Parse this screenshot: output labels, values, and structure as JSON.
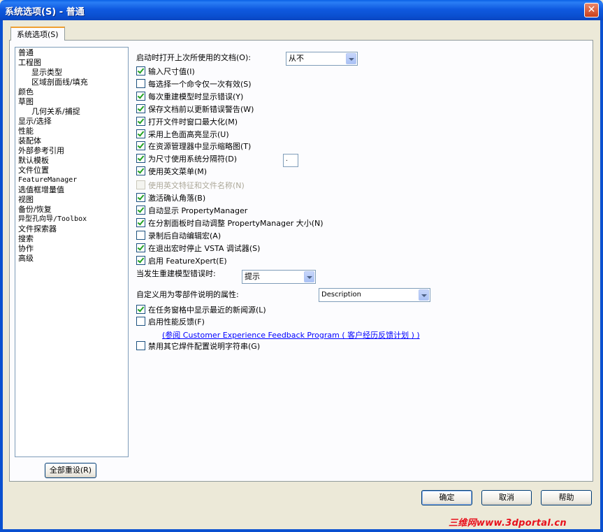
{
  "window": {
    "title": "系统选项(S) - 普通",
    "close_glyph": "✕"
  },
  "tab": {
    "label": "系统选项(S)"
  },
  "tree": [
    {
      "label": "普通",
      "indent": false
    },
    {
      "label": "工程图",
      "indent": false
    },
    {
      "label": "显示类型",
      "indent": true
    },
    {
      "label": "区域剖面线/填充",
      "indent": true
    },
    {
      "label": "颜色",
      "indent": false
    },
    {
      "label": "草图",
      "indent": false
    },
    {
      "label": "几何关系/捕捉",
      "indent": true
    },
    {
      "label": "显示/选择",
      "indent": false
    },
    {
      "label": "性能",
      "indent": false
    },
    {
      "label": "装配体",
      "indent": false
    },
    {
      "label": "外部参考引用",
      "indent": false
    },
    {
      "label": "默认模板",
      "indent": false
    },
    {
      "label": "文件位置",
      "indent": false
    },
    {
      "label": "FeatureManager",
      "indent": false,
      "mono": true
    },
    {
      "label": "选值框增量值",
      "indent": false
    },
    {
      "label": "视图",
      "indent": false
    },
    {
      "label": "备份/恢复",
      "indent": false
    },
    {
      "label": "异型孔向导/Toolbox",
      "indent": false,
      "mono": true
    },
    {
      "label": "文件探索器",
      "indent": false
    },
    {
      "label": "搜索",
      "indent": false
    },
    {
      "label": "协作",
      "indent": false
    },
    {
      "label": "高级",
      "indent": false
    }
  ],
  "reset_button": "全部重设(R)",
  "open_docs": {
    "label": "启动时打开上次所使用的文档(O):",
    "value": "从不"
  },
  "options": [
    {
      "label": "输入尺寸值(I)",
      "checked": true,
      "enabled": true
    },
    {
      "label": "每选择一个命令仅一次有效(S)",
      "checked": false,
      "enabled": true
    },
    {
      "label": "每次重建模型时显示错误(Y)",
      "checked": true,
      "enabled": true
    },
    {
      "label": "保存文档前以更新错误警告(W)",
      "checked": true,
      "enabled": true
    },
    {
      "label": "打开文件时窗口最大化(M)",
      "checked": true,
      "enabled": true
    },
    {
      "label": "采用上色面高亮显示(U)",
      "checked": true,
      "enabled": true
    },
    {
      "label": "在资源管理器中显示缩略图(T)",
      "checked": true,
      "enabled": true
    },
    {
      "label": "为尺寸使用系统分隔符(D)",
      "checked": true,
      "enabled": true
    },
    {
      "label": "使用英文菜单(M)",
      "checked": true,
      "enabled": true
    },
    {
      "label": "使用英文特征和文件名称(N)",
      "checked": false,
      "enabled": false
    },
    {
      "label": "激活确认角落(B)",
      "checked": true,
      "enabled": true
    },
    {
      "label": "自动显示 PropertyManager",
      "checked": true,
      "enabled": true
    },
    {
      "label": "在分割面板时自动调整 PropertyManager 大小(N)",
      "checked": true,
      "enabled": true
    },
    {
      "label": "录制后自动编辑宏(A)",
      "checked": false,
      "enabled": true
    },
    {
      "label": "在退出宏时停止 VSTA 调试器(S)",
      "checked": true,
      "enabled": true
    },
    {
      "label": "启用 FeatureXpert(E)",
      "checked": true,
      "enabled": true
    }
  ],
  "separator_value": ".",
  "rebuild_error": {
    "label": "当发生重建模型错误时:",
    "value": "提示"
  },
  "custom_prop": {
    "label": "自定义用为零部件说明的属性:",
    "value": "Description"
  },
  "options2": [
    {
      "label": "在任务窗格中显示最近的新闻源(L)",
      "checked": true
    },
    {
      "label": "启用性能反馈(F)",
      "checked": false
    }
  ],
  "feedback_link": "(参阅 Customer Experience Feedback Program ( 客户经历反馈计划 ) )",
  "option_last": {
    "label": "禁用其它焊件配置说明字符串(G)",
    "checked": false
  },
  "buttons": {
    "ok": "确定",
    "cancel": "取消",
    "help": "帮助"
  },
  "watermark": "三维网www.3dportal.cn"
}
